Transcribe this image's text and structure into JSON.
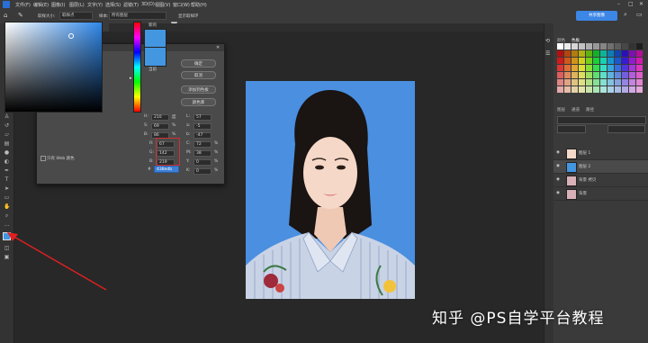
{
  "menubar": {
    "items": [
      "文件(F)",
      "编辑(E)",
      "图像(I)",
      "图层(L)",
      "文字(Y)",
      "选择(S)",
      "滤镜(T)",
      "3D(D)",
      "视图(V)",
      "窗口(W)",
      "帮助(H)"
    ]
  },
  "options": {
    "sample_label": "取样大小:",
    "sample_value": "取样点",
    "layers_label": "样本:",
    "layers_value": "所有图层",
    "show_ring_label": "显示取样环",
    "share_label": "共享图像"
  },
  "document": {
    "tab_label": "图片 - 副本.psd @ 33.3% (图层 2, RGB/8#)"
  },
  "picker": {
    "title": "拾色器（前景色）",
    "new_label": "新的",
    "current_label": "当前",
    "ok": "确定",
    "cancel": "取消",
    "add_swatch": "添加到色板",
    "libraries": "颜色库",
    "web_only": "只有 Web 颜色",
    "fields": {
      "H": "210",
      "S": "69",
      "B": "86",
      "R": "67",
      "G": "142",
      "Bl": "219",
      "L": "57",
      "a": "-5",
      "b": "-47",
      "C": "72",
      "M": "38",
      "Y": "0",
      "K": "0"
    },
    "units": {
      "deg": "度",
      "pct": "%"
    },
    "hex_label": "#",
    "hex": "438edb"
  },
  "panels": {
    "tabs": [
      "颜色",
      "色板"
    ],
    "layer_tabs": [
      "图层",
      "通道",
      "路径"
    ],
    "layers": [
      {
        "name": "图层 1"
      },
      {
        "name": "图层 2"
      },
      {
        "name": "背景 拷贝"
      },
      {
        "name": "背景"
      }
    ]
  },
  "watermark": {
    "text": "知乎 @PS自学平台教程"
  },
  "colors": {
    "accent": "#3c86e6",
    "photo_bg": "#4a8fe0",
    "arrow": "#e02020"
  }
}
